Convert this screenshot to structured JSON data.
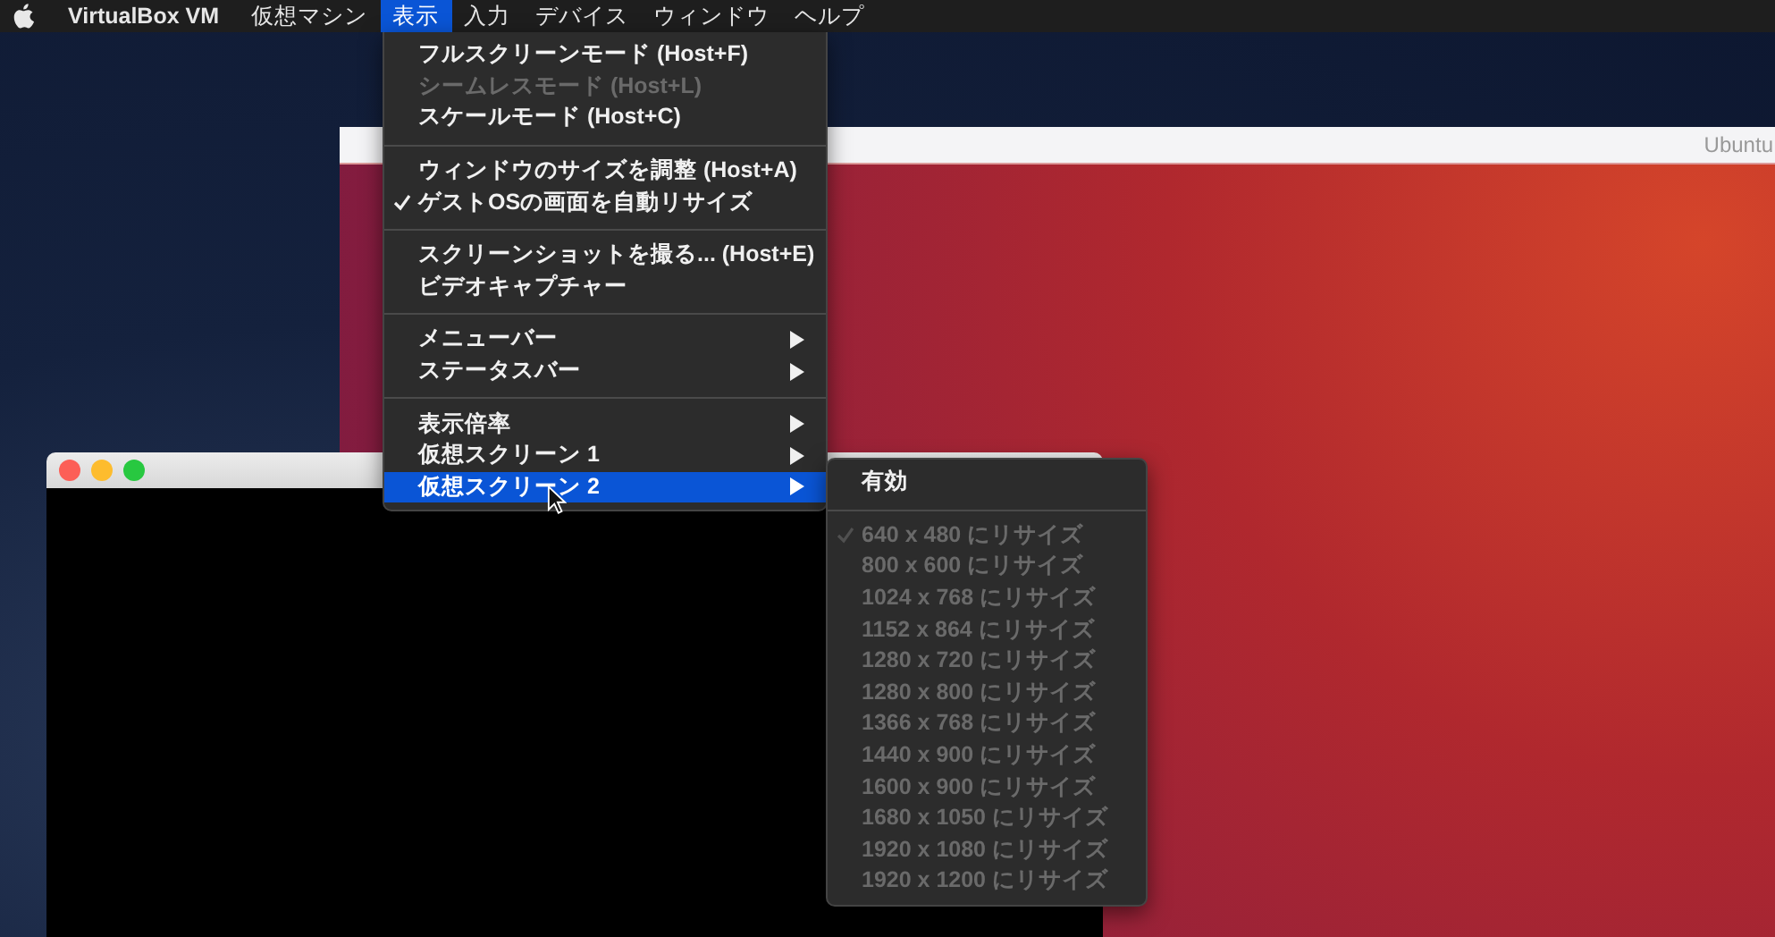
{
  "menubar": {
    "items": [
      {
        "label": "VirtualBox VM",
        "selected": false,
        "kind": "app"
      },
      {
        "label": "仮想マシン",
        "selected": false,
        "kind": "menu"
      },
      {
        "label": "表示",
        "selected": true,
        "kind": "menu"
      },
      {
        "label": "入力",
        "selected": false,
        "kind": "menu"
      },
      {
        "label": "デバイス",
        "selected": false,
        "kind": "menu"
      },
      {
        "label": "ウィンドウ",
        "selected": false,
        "kind": "menu"
      },
      {
        "label": "ヘルプ",
        "selected": false,
        "kind": "menu"
      }
    ]
  },
  "ubuntu_window": {
    "title": "Ubuntu"
  },
  "menu": {
    "groups": [
      [
        {
          "label": "フルスクリーンモード (Host+F)",
          "disabled": false,
          "checked": false,
          "submenu": false,
          "selected": false
        },
        {
          "label": "シームレスモード (Host+L)",
          "disabled": true,
          "checked": false,
          "submenu": false,
          "selected": false
        },
        {
          "label": "スケールモード (Host+C)",
          "disabled": false,
          "checked": false,
          "submenu": false,
          "selected": false
        }
      ],
      [
        {
          "label": "ウィンドウのサイズを調整 (Host+A)",
          "disabled": false,
          "checked": false,
          "submenu": false,
          "selected": false
        },
        {
          "label": "ゲストOSの画面を自動リサイズ",
          "disabled": false,
          "checked": true,
          "submenu": false,
          "selected": false
        }
      ],
      [
        {
          "label": "スクリーンショットを撮る... (Host+E)",
          "disabled": false,
          "checked": false,
          "submenu": false,
          "selected": false
        },
        {
          "label": "ビデオキャプチャー",
          "disabled": false,
          "checked": false,
          "submenu": false,
          "selected": false
        }
      ],
      [
        {
          "label": "メニューバー",
          "disabled": false,
          "checked": false,
          "submenu": true,
          "selected": false
        },
        {
          "label": "ステータスバー",
          "disabled": false,
          "checked": false,
          "submenu": true,
          "selected": false
        }
      ],
      [
        {
          "label": "表示倍率",
          "disabled": false,
          "checked": false,
          "submenu": true,
          "selected": false
        },
        {
          "label": "仮想スクリーン 1",
          "disabled": false,
          "checked": false,
          "submenu": true,
          "selected": false
        },
        {
          "label": "仮想スクリーン 2",
          "disabled": false,
          "checked": false,
          "submenu": true,
          "selected": true
        }
      ]
    ]
  },
  "submenu": {
    "groups": [
      [
        {
          "label": "有効",
          "disabled": false,
          "checked": false,
          "submenu": false,
          "selected": false
        }
      ],
      [
        {
          "label": "640 x 480 にリサイズ",
          "disabled": true,
          "checked": true,
          "submenu": false,
          "selected": false
        },
        {
          "label": "800 x 600 にリサイズ",
          "disabled": true,
          "checked": false,
          "submenu": false,
          "selected": false
        },
        {
          "label": "1024 x 768 にリサイズ",
          "disabled": true,
          "checked": false,
          "submenu": false,
          "selected": false
        },
        {
          "label": "1152 x 864 にリサイズ",
          "disabled": true,
          "checked": false,
          "submenu": false,
          "selected": false
        },
        {
          "label": "1280 x 720 にリサイズ",
          "disabled": true,
          "checked": false,
          "submenu": false,
          "selected": false
        },
        {
          "label": "1280 x 800 にリサイズ",
          "disabled": true,
          "checked": false,
          "submenu": false,
          "selected": false
        },
        {
          "label": "1366 x 768 にリサイズ",
          "disabled": true,
          "checked": false,
          "submenu": false,
          "selected": false
        },
        {
          "label": "1440 x 900 にリサイズ",
          "disabled": true,
          "checked": false,
          "submenu": false,
          "selected": false
        },
        {
          "label": "1600 x 900 にリサイズ",
          "disabled": true,
          "checked": false,
          "submenu": false,
          "selected": false
        },
        {
          "label": "1680 x 1050 にリサイズ",
          "disabled": true,
          "checked": false,
          "submenu": false,
          "selected": false
        },
        {
          "label": "1920 x 1080 にリサイズ",
          "disabled": true,
          "checked": false,
          "submenu": false,
          "selected": false
        },
        {
          "label": "1920 x 1200 にリサイズ",
          "disabled": true,
          "checked": false,
          "submenu": false,
          "selected": false
        }
      ]
    ]
  }
}
